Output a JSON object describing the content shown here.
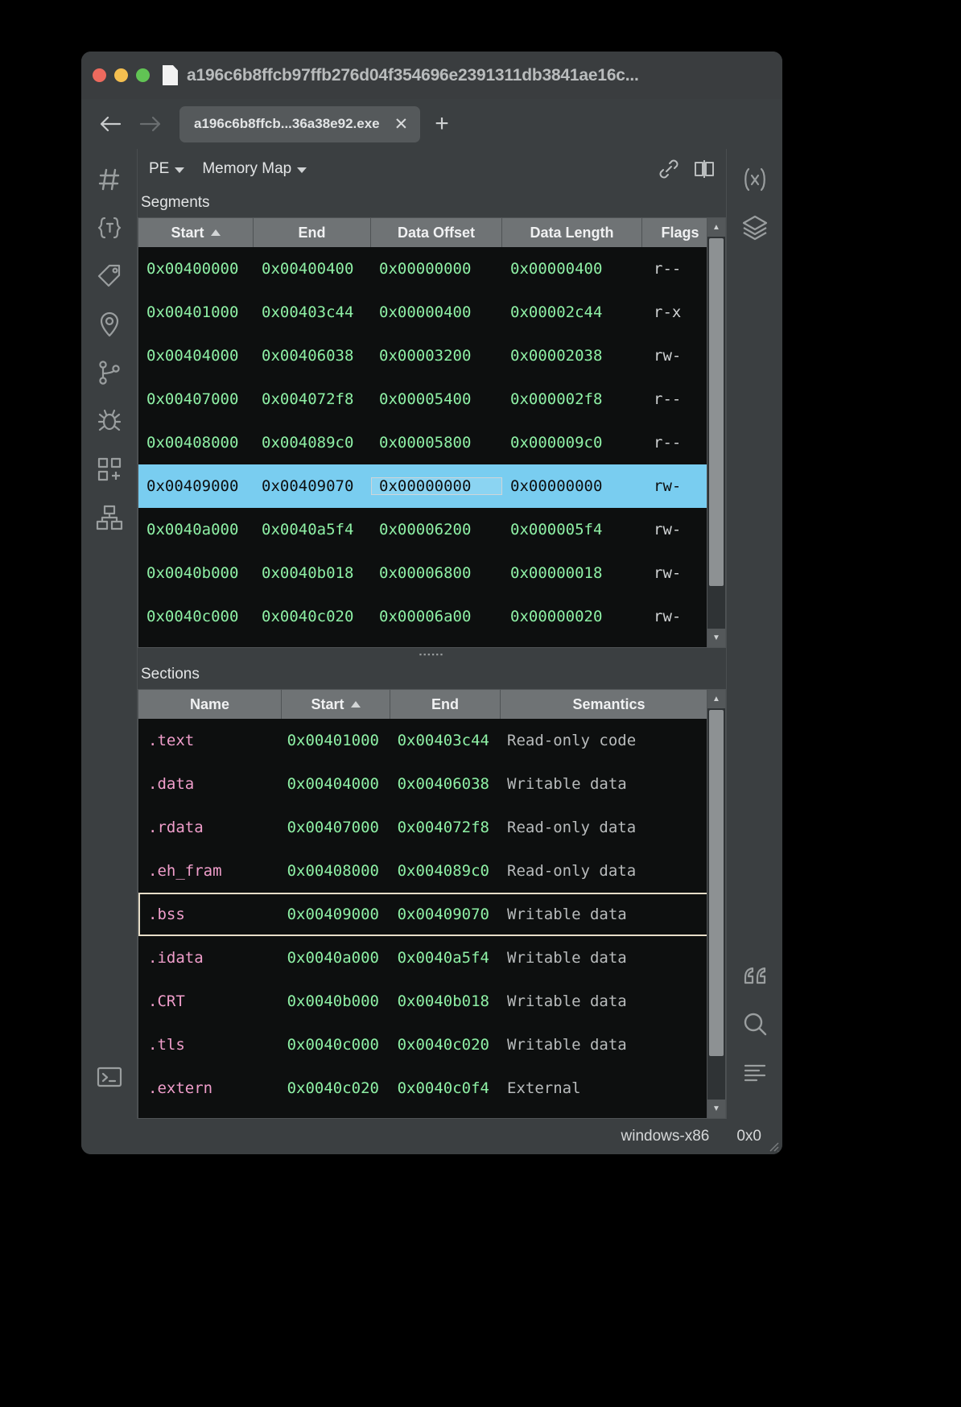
{
  "window": {
    "title": "a196c6b8ffcb97ffb276d04f354696e2391311db3841ae16c...",
    "doc_icon": "document-icon"
  },
  "tabbar": {
    "back_icon": "arrow-left-icon",
    "forward_icon": "arrow-right-icon",
    "tab_label": "a196c6b8ffcb...36a38e92.exe",
    "close_icon": "close-icon",
    "new_tab_icon": "plus-icon"
  },
  "toolbar": {
    "format_menu": "PE",
    "view_menu": "Memory Map",
    "link_icon": "link-icon",
    "split_icon": "split-pane-icon"
  },
  "left_rail": [
    {
      "name": "hash-icon"
    },
    {
      "name": "types-icon"
    },
    {
      "name": "tag-icon"
    },
    {
      "name": "location-pin-icon"
    },
    {
      "name": "graph-branch-icon"
    },
    {
      "name": "bug-icon"
    },
    {
      "name": "components-icon"
    },
    {
      "name": "hierarchy-icon"
    },
    {
      "name": "terminal-icon"
    }
  ],
  "right_rail": [
    {
      "name": "variables-icon"
    },
    {
      "name": "layers-icon"
    },
    {
      "name": "comments-icon"
    },
    {
      "name": "search-icon"
    },
    {
      "name": "log-icon"
    }
  ],
  "segments": {
    "title": "Segments",
    "columns": [
      "Start",
      "End",
      "Data Offset",
      "Data Length",
      "Flags"
    ],
    "sort_column": "Start",
    "sort_direction": "asc",
    "rows": [
      {
        "start": "0x00400000",
        "end": "0x00400400",
        "data_offset": "0x00000000",
        "data_length": "0x00000400",
        "flags": "r--",
        "selected": false
      },
      {
        "start": "0x00401000",
        "end": "0x00403c44",
        "data_offset": "0x00000400",
        "data_length": "0x00002c44",
        "flags": "r-x",
        "selected": false
      },
      {
        "start": "0x00404000",
        "end": "0x00406038",
        "data_offset": "0x00003200",
        "data_length": "0x00002038",
        "flags": "rw-",
        "selected": false
      },
      {
        "start": "0x00407000",
        "end": "0x004072f8",
        "data_offset": "0x00005400",
        "data_length": "0x000002f8",
        "flags": "r--",
        "selected": false
      },
      {
        "start": "0x00408000",
        "end": "0x004089c0",
        "data_offset": "0x00005800",
        "data_length": "0x000009c0",
        "flags": "r--",
        "selected": false
      },
      {
        "start": "0x00409000",
        "end": "0x00409070",
        "data_offset": "0x00000000",
        "data_length": "0x00000000",
        "flags": "rw-",
        "selected": true
      },
      {
        "start": "0x0040a000",
        "end": "0x0040a5f4",
        "data_offset": "0x00006200",
        "data_length": "0x000005f4",
        "flags": "rw-",
        "selected": false
      },
      {
        "start": "0x0040b000",
        "end": "0x0040b018",
        "data_offset": "0x00006800",
        "data_length": "0x00000018",
        "flags": "rw-",
        "selected": false
      },
      {
        "start": "0x0040c000",
        "end": "0x0040c020",
        "data_offset": "0x00006a00",
        "data_length": "0x00000020",
        "flags": "rw-",
        "selected": false
      }
    ]
  },
  "sections": {
    "title": "Sections",
    "columns": [
      "Name",
      "Start",
      "End",
      "Semantics"
    ],
    "sort_column": "Start",
    "sort_direction": "asc",
    "rows": [
      {
        "name": ".text",
        "start": "0x00401000",
        "end": "0x00403c44",
        "semantics": "Read-only code",
        "focused": false
      },
      {
        "name": ".data",
        "start": "0x00404000",
        "end": "0x00406038",
        "semantics": "Writable data",
        "focused": false
      },
      {
        "name": ".rdata",
        "start": "0x00407000",
        "end": "0x004072f8",
        "semantics": "Read-only data",
        "focused": false
      },
      {
        "name": ".eh_fram",
        "start": "0x00408000",
        "end": "0x004089c0",
        "semantics": "Read-only data",
        "focused": false
      },
      {
        "name": ".bss",
        "start": "0x00409000",
        "end": "0x00409070",
        "semantics": "Writable data",
        "focused": true
      },
      {
        "name": ".idata",
        "start": "0x0040a000",
        "end": "0x0040a5f4",
        "semantics": "Writable data",
        "focused": false
      },
      {
        "name": ".CRT",
        "start": "0x0040b000",
        "end": "0x0040b018",
        "semantics": "Writable data",
        "focused": false
      },
      {
        "name": ".tls",
        "start": "0x0040c000",
        "end": "0x0040c020",
        "semantics": "Writable data",
        "focused": false
      },
      {
        "name": ".extern",
        "start": "0x0040c020",
        "end": "0x0040c0f4",
        "semantics": "External",
        "focused": false
      }
    ]
  },
  "statusbar": {
    "platform": "windows-x86",
    "address": "0x0"
  },
  "colors": {
    "accent_selection": "#79cdf0",
    "hex_green": "#8ef0a5",
    "section_pink": "#f09ecb",
    "window_bg": "#3b3f41",
    "table_bg": "#0d0f0f",
    "focus_outline": "#e6ddc8"
  }
}
